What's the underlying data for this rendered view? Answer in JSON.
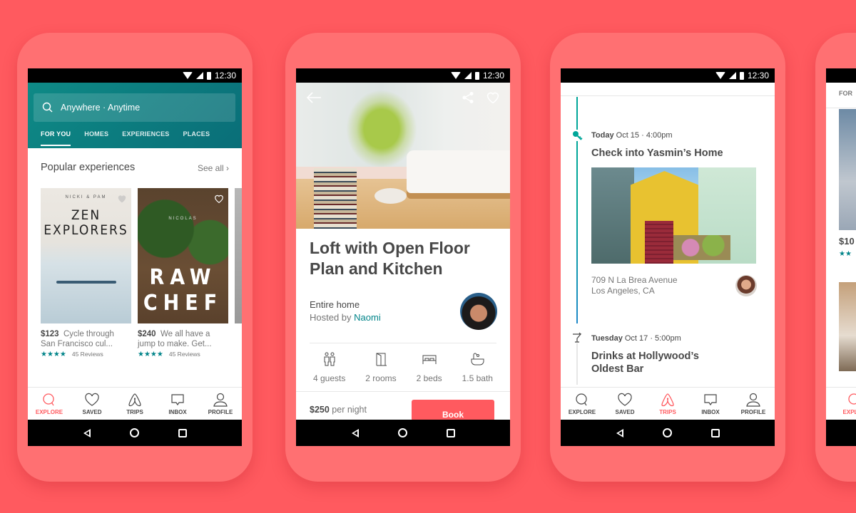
{
  "status_bar": {
    "time": "12:30"
  },
  "colors": {
    "brand": "#FF5A5F",
    "teal": "#008489",
    "header_teal": "#0E8A86",
    "text": "#484848",
    "muted": "#767676"
  },
  "tab_bar": [
    {
      "label": "EXPLORE",
      "icon": "search-icon"
    },
    {
      "label": "SAVED",
      "icon": "heart-icon"
    },
    {
      "label": "TRIPS",
      "icon": "airbnb-logo-icon"
    },
    {
      "label": "INBOX",
      "icon": "message-icon"
    },
    {
      "label": "PROFILE",
      "icon": "profile-icon"
    }
  ],
  "explore_screen": {
    "search_placeholder": "Anywhere · Anytime",
    "tabs": [
      {
        "label": "FOR YOU",
        "active": true
      },
      {
        "label": "HOMES",
        "active": false
      },
      {
        "label": "EXPERIENCES",
        "active": false
      },
      {
        "label": "PLACES",
        "active": false
      }
    ],
    "section_title": "Popular experiences",
    "see_all": "See all",
    "cards": [
      {
        "byline": "NICKI & PAM",
        "cover_title": "ZEN EXPLORERS",
        "price": "$123",
        "desc_line1": "Cycle through",
        "desc_line2": "San Francisco cul...",
        "stars": "★★★★",
        "rating": 4,
        "reviews": "45 Reviews"
      },
      {
        "byline": "NICOLAS",
        "cover_title": "RAW CHEF",
        "price": "$240",
        "desc_line1": "We all have a",
        "desc_line2": "jump to make. Get...",
        "stars": "★★★★",
        "rating": 4,
        "reviews": "45 Reviews"
      }
    ],
    "active_tab": "EXPLORE"
  },
  "listing_screen": {
    "title": "Loft with Open Floor Plan and Kitchen",
    "type": "Entire home",
    "hosted_by": "Hosted by",
    "host_name": "Naomi",
    "amenities": [
      {
        "label": "4 guests",
        "icon": "guests-icon"
      },
      {
        "label": "2 rooms",
        "icon": "door-icon"
      },
      {
        "label": "2 beds",
        "icon": "bed-icon"
      },
      {
        "label": "1.5 bath",
        "icon": "bath-icon"
      }
    ],
    "price": "$250",
    "price_unit": "per night",
    "book_label": "Book"
  },
  "trips_screen": {
    "events": [
      {
        "day": "Today",
        "when": "Oct 15 · 4:00pm",
        "title": "Check into Yasmin’s Home",
        "address_line1": "709 N La Brea Avenue",
        "address_line2": "Los Angeles, CA",
        "icon": "key-icon"
      },
      {
        "day": "Tuesday",
        "when": "Oct 17 · 5:00pm",
        "title": "Drinks at Hollywood’s Oldest Bar",
        "icon": "cocktail-icon"
      }
    ],
    "active_tab": "TRIPS"
  },
  "peek_screen": {
    "tab_fragment": "FOR",
    "price_fragment": "$10",
    "stars": "★★",
    "tab_fragment_bottom": "EXPLOR"
  }
}
